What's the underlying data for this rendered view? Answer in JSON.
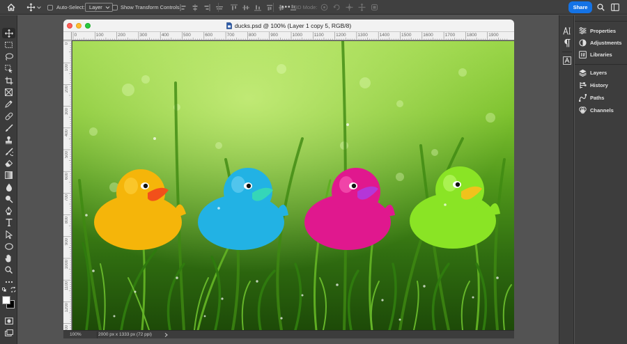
{
  "options_bar": {
    "auto_select_label": "Auto-Select:",
    "auto_select_target": "Layer",
    "show_transform_label": "Show Transform Controls",
    "mode_3d_label": "3D Mode:",
    "share_label": "Share"
  },
  "document": {
    "title": "ducks.psd @ 100% (Layer 1 copy 5, RGB/8)",
    "zoom": "100%",
    "info": "2000 px x 1333 px (72 ppi)",
    "ruler_top": [
      "0",
      "100",
      "200",
      "300",
      "400",
      "500",
      "600",
      "700",
      "800",
      "900",
      "1000",
      "1100",
      "1200",
      "1300",
      "1400",
      "1500",
      "1600",
      "1700",
      "1800",
      "1900"
    ],
    "ruler_left": [
      "0",
      "100",
      "200",
      "300",
      "400",
      "500",
      "600",
      "700",
      "800",
      "900",
      "1000",
      "1100",
      "1200",
      "1300"
    ],
    "ducks": [
      {
        "name": "yellow-duck",
        "body": "#f5b50a",
        "beak": "#f2501a"
      },
      {
        "name": "blue-duck",
        "body": "#22b2e4",
        "beak": "#35d6b8"
      },
      {
        "name": "magenta-duck",
        "body": "#e0188e",
        "beak": "#b436d8"
      },
      {
        "name": "green-duck",
        "body": "#8ae425",
        "beak": "#f0c21c"
      }
    ]
  },
  "panels": {
    "top_group": [
      "Properties",
      "Adjustments",
      "Libraries"
    ],
    "bottom_group": [
      "Layers",
      "History",
      "Paths",
      "Channels"
    ]
  },
  "colors": {
    "accent": "#1473e6",
    "foreground": "#ffffff",
    "background": "#000000"
  }
}
